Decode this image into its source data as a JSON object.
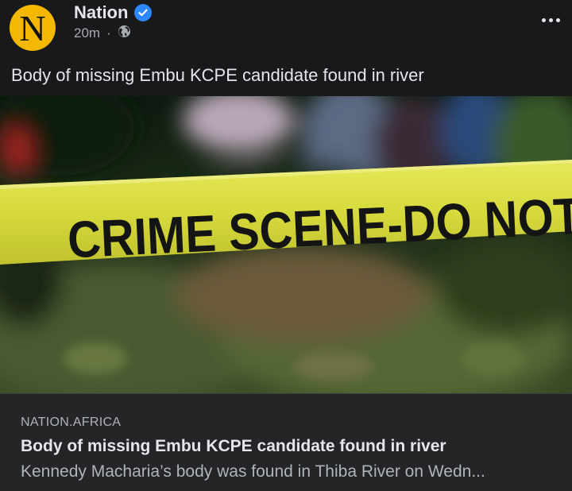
{
  "post": {
    "page_name": "Nation",
    "avatar_letter": "N",
    "time": "20m",
    "separator": "·",
    "privacy_icon": "globe-icon",
    "text": "Body of missing Embu KCPE candidate found in river"
  },
  "image": {
    "tape_text": "CRIME SCENE-DO NOT ENTER"
  },
  "link": {
    "domain": "NATION.AFRICA",
    "title": "Body of missing Embu KCPE candidate found in river",
    "description": "Kennedy Macharia’s body was found in Thiba River on Wedn..."
  },
  "colors": {
    "background": "#18191a",
    "avatar": "#f5b800",
    "verified": "#2d88ff",
    "tape": "#d8dc3a",
    "link_box": "#242526"
  }
}
